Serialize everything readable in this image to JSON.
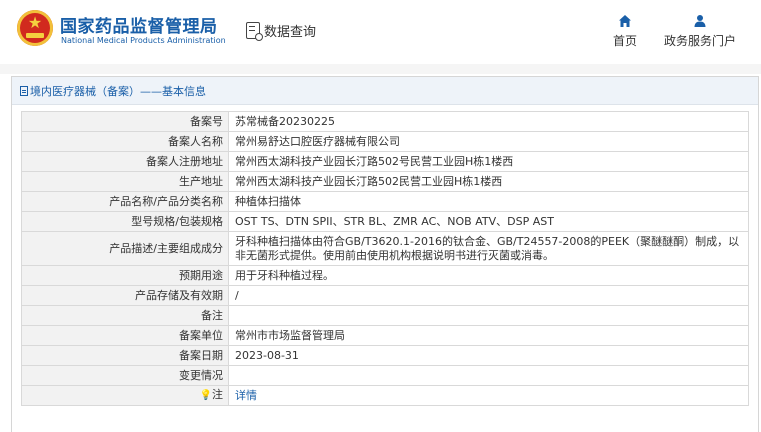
{
  "header": {
    "title_cn": "国家药品监督管理局",
    "title_en": "National Medical Products Administration",
    "query_label": "数据查询",
    "nav": [
      {
        "label": "首页",
        "icon": "home-icon"
      },
      {
        "label": "政务服务门户",
        "icon": "user-icon"
      }
    ]
  },
  "panel": {
    "title": "境内医疗器械（备案）——基本信息"
  },
  "rows": [
    {
      "label": "备案号",
      "value": "苏常械备20230225"
    },
    {
      "label": "备案人名称",
      "value": "常州易舒达口腔医疗器械有限公司"
    },
    {
      "label": "备案人注册地址",
      "value": "常州西太湖科技产业园长汀路502号民营工业园H栋1楼西"
    },
    {
      "label": "生产地址",
      "value": "常州西太湖科技产业园长汀路502民营工业园H栋1楼西"
    },
    {
      "label": "产品名称/产品分类名称",
      "value": "种植体扫描体"
    },
    {
      "label": "型号规格/包装规格",
      "value": "OST TS、DTN SPII、STR BL、ZMR AC、NOB ATV、DSP AST"
    },
    {
      "label": "产品描述/主要组成成分",
      "value": "牙科种植扫描体由符合GB/T3620.1-2016的钛合金、GB/T24557-2008的PEEK（聚醚醚酮）制成，以非无菌形式提供。使用前由使用机构根据说明书进行灭菌或消毒。"
    },
    {
      "label": "预期用途",
      "value": "用于牙科种植过程。"
    },
    {
      "label": "产品存储及有效期",
      "value": "/"
    },
    {
      "label": "备注",
      "value": ""
    },
    {
      "label": "备案单位",
      "value": "常州市市场监督管理局"
    },
    {
      "label": "备案日期",
      "value": "2023-08-31"
    },
    {
      "label": "变更情况",
      "value": ""
    },
    {
      "label": "注",
      "value": "详情"
    }
  ],
  "colors": {
    "brand_blue": "#1a5fa8",
    "emblem_red": "#d12a1e",
    "label_bg": "#f2f2f2"
  }
}
